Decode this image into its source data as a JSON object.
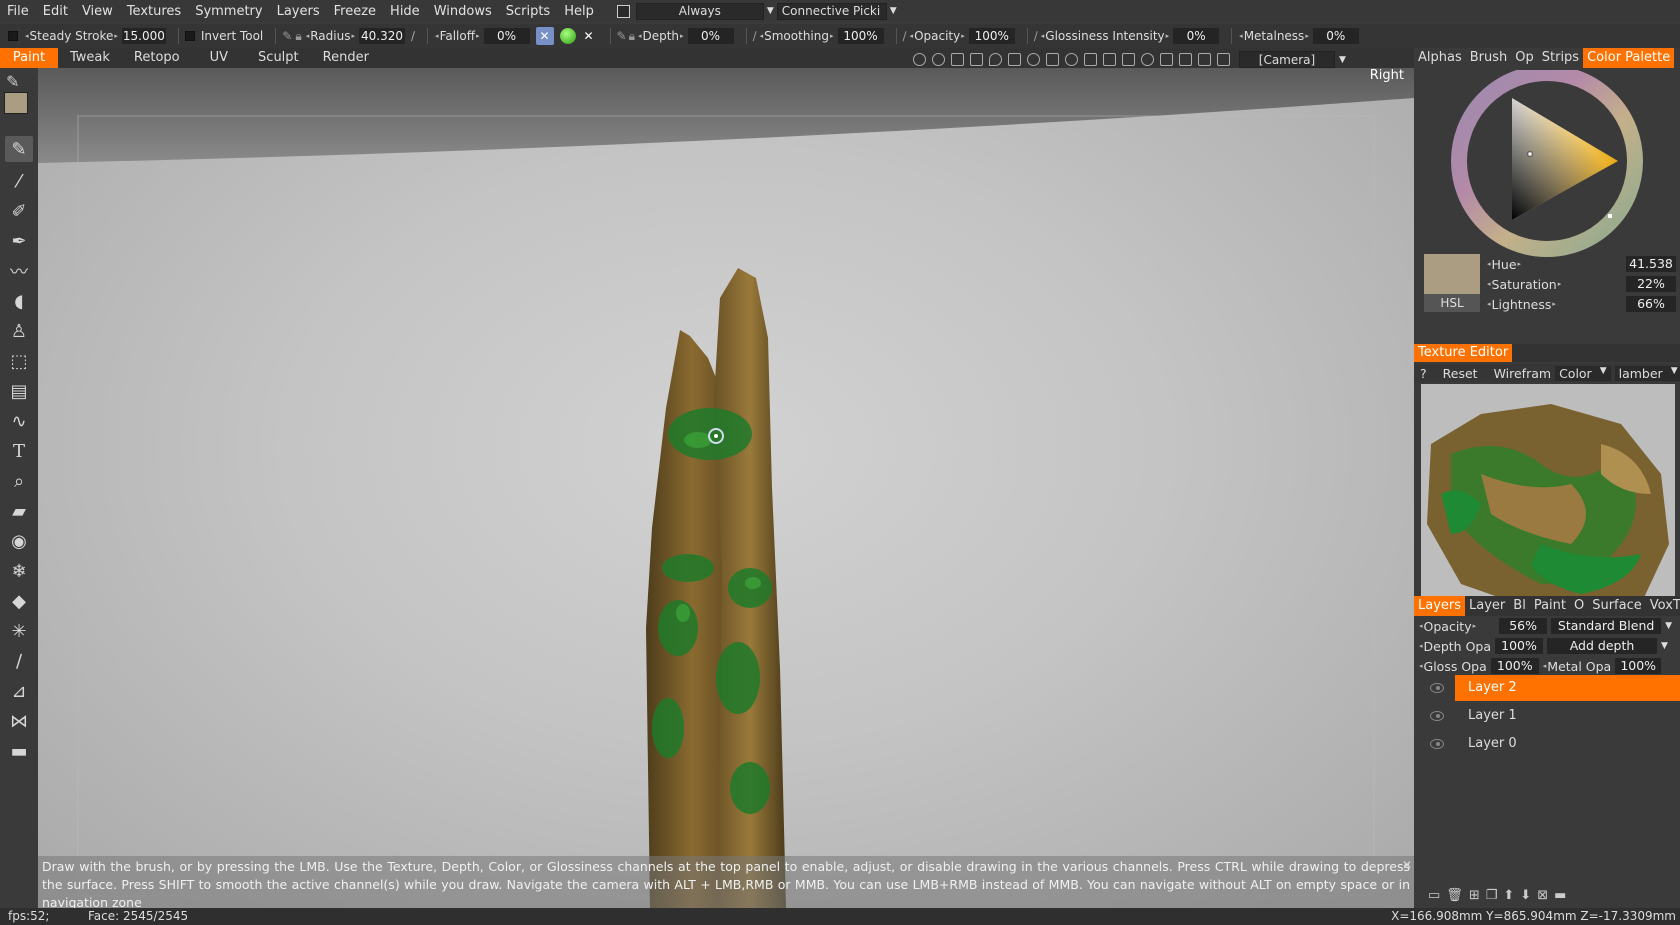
{
  "menu": [
    "File",
    "Edit",
    "View",
    "Textures",
    "Symmetry",
    "Layers",
    "Freeze",
    "Hide",
    "Windows",
    "Scripts",
    "Help"
  ],
  "menu_always": "Always",
  "menu_connective": "Connective Picki",
  "toolbar": {
    "steady_stroke_label": "Steady  Stroke",
    "steady_stroke_value": "15.000",
    "invert_tool_label": "Invert  Tool",
    "radius_label": "Radius",
    "radius_value": "40.320",
    "falloff_label": "Falloff",
    "falloff_value": "0%",
    "depth_label": "Depth",
    "depth_value": "0%",
    "smoothing_label": "Smoothing",
    "smoothing_value": "100%",
    "opacity_label": "Opacity",
    "opacity_value": "100%",
    "glossiness_label": "Glossiness  Intensity",
    "glossiness_value": "0%",
    "metalness_label": "Metalness",
    "metalness_value": "0%"
  },
  "tabs": [
    "Paint",
    "Tweak",
    "Retopo",
    "UV",
    "Sculpt",
    "Render"
  ],
  "camera_select": "[Camera]",
  "viewport": {
    "view_label": "Right"
  },
  "hint": "Draw with the brush, or by pressing the LMB. Use the Texture, Depth, Color, or Glossiness channels at the top panel to enable, adjust, or disable drawing in the various channels. Press CTRL while drawing to depress the surface. Press SHIFT to smooth the active channel(s) while you draw. Navigate the camera with ALT + LMB,RMB or MMB. You can use LMB+RMB instead of MMB. You can navigate without ALT on empty space or in navigation zone",
  "status": {
    "fps": "fps:52;",
    "faces": "Face: 2545/2545",
    "coords": "X=166.908mm  Y=865.904mm  Z=-17.3309mm"
  },
  "right_tabs": [
    "Alphas",
    "Brush",
    "Op",
    "Strips",
    "Color Palette"
  ],
  "color": {
    "swatch": "#ab9d82",
    "mode_label": "HSL",
    "hue_label": "Hue",
    "hue_value": "41.538",
    "saturation_label": "Saturation",
    "saturation_value": "22%",
    "lightness_label": "Lightness",
    "lightness_value": "66%"
  },
  "texture_editor": {
    "title": "Texture  Editor",
    "help": "?",
    "reset": "Reset",
    "wireframe": "Wirefram",
    "channel": "Color",
    "shader": "lamber"
  },
  "layers_tabs": [
    "Layers",
    "Layer",
    "Bl",
    "Paint",
    "O",
    "Surface",
    "VoxTree"
  ],
  "layers_panel": {
    "opacity_label": "Opacity",
    "opacity_value": "56%",
    "blend_mode": "Standard  Blend",
    "depth_label": "Depth  Opa",
    "depth_value": "100%",
    "depth_mode": "Add  depth",
    "gloss_label": "Gloss  Opa",
    "gloss_value": "100%",
    "metal_label": "Metal  Opa",
    "metal_value": "100%"
  },
  "layers": [
    "Layer  2",
    "Layer  1",
    "Layer  0"
  ],
  "colors": {
    "accent": "#ff7200"
  }
}
